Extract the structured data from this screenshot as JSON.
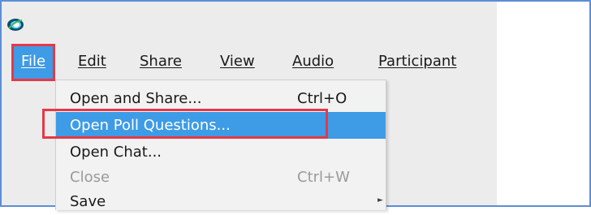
{
  "menu_bar": {
    "items": [
      {
        "label": "File",
        "mnemonic_index": 0
      },
      {
        "label": "Edit",
        "mnemonic_index": 0
      },
      {
        "label": "Share",
        "mnemonic_index": 0
      },
      {
        "label": "View",
        "mnemonic_index": 0
      },
      {
        "label": "Audio",
        "mnemonic_index": 0
      },
      {
        "label": "Participant",
        "mnemonic_index": 0
      }
    ],
    "active": "File"
  },
  "file_menu": {
    "items": [
      {
        "label": "Open and Share...",
        "shortcut": "Ctrl+O",
        "state": "normal"
      },
      {
        "label": "Open Poll Questions...",
        "shortcut": "",
        "state": "selected"
      },
      {
        "label": "Open Chat...",
        "shortcut": "",
        "state": "normal"
      },
      {
        "label": "Close",
        "shortcut": "Ctrl+W",
        "state": "disabled"
      },
      {
        "label": "Save",
        "shortcut": "",
        "state": "normal",
        "has_submenu": true
      }
    ]
  },
  "colors": {
    "highlight": "#3e9be6",
    "annotation_box": "#e53945",
    "frame_border": "#5b8fd6"
  },
  "icons": {
    "app": "webex-logo-icon",
    "submenu": "submenu-arrow-icon"
  }
}
